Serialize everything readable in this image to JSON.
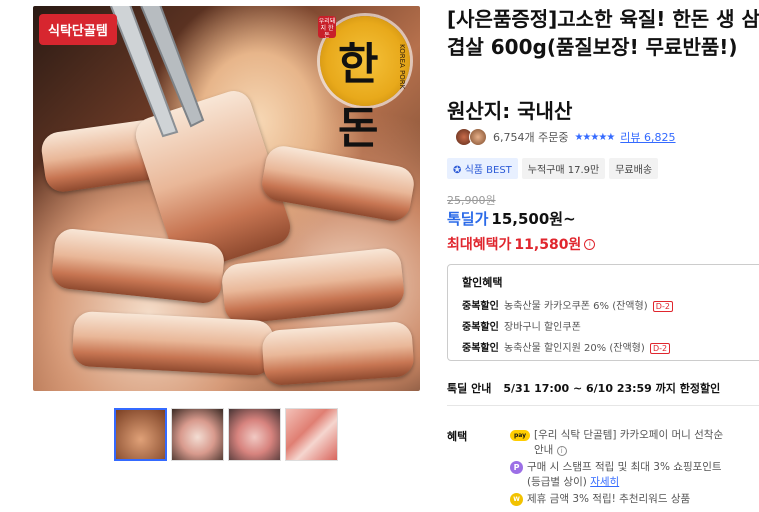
{
  "image": {
    "badge": "식탁단골템",
    "logo_text": "한돈",
    "logo_sub": "KOREA PORK",
    "logo_stamp": "우리돼지 한돈"
  },
  "product": {
    "title": "[사은품증정]고소한 육질! 한돈 생 삼겹살 600g(품질보장! 무료반품!)",
    "origin": "원산지: 국내산"
  },
  "rating": {
    "orders": "6,754개 주문중",
    "stars": "★★★★★",
    "reviews": "리뷰 6,825"
  },
  "tags": [
    "식품 BEST",
    "누적구매 17.9만",
    "무료배송"
  ],
  "price": {
    "original": "25,900원",
    "deal_label": "톡딜가",
    "deal_price": "15,500원~",
    "max_label": "최대혜택가",
    "max_price": "11,580원",
    "info_icon": "i"
  },
  "discount": {
    "title": "할인혜택",
    "lines": [
      {
        "label": "중복할인",
        "text": "농축산물 카카오쿠폰 6% (잔액형)",
        "dday": "D-2"
      },
      {
        "label": "중복할인",
        "text": "장바구니 할인쿠폰",
        "dday": ""
      },
      {
        "label": "중복할인",
        "text": "농축산물 할인지원 20% (잔액형)",
        "dday": "D-2"
      }
    ]
  },
  "period": {
    "label": "톡딜 안내",
    "text": "5/31 17:00 ~ 6/10 23:59 까지 한정할인"
  },
  "benefit": {
    "label": "혜택",
    "kpay": "pay",
    "pcoin": "P",
    "wcoin": "W",
    "item1_line1": "[우리 식탁 단골템] 카카오페이 머니 선착순",
    "item1_line2": "안내",
    "item2_line1": "구매 시 스탬프 적립 및 최대 3% 쇼핑포인트",
    "item2_line2": "(등급별 상이)",
    "item2_link": "자세히",
    "item3": "제휴 금액 3% 적립! 추천리워드 상품",
    "info": "i"
  },
  "colors": {
    "accent_blue": "#346aff",
    "deal_blue": "#2b6ae8",
    "benefit_red": "#e0262e",
    "badge_red": "#d7262f"
  }
}
